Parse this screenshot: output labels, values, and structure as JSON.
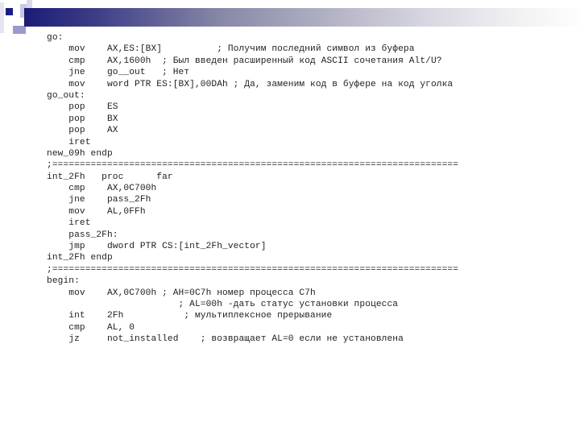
{
  "slide": {
    "code_lines": [
      "go:",
      "    mov    AX,ES:[BX]          ; Получим последний символ из буфера",
      "    cmp    AX,1600h  ; Был введен расширенный код ASCII сочетания Alt/U?",
      "    jne    go__out   ; Нет",
      "    mov    word PTR ES:[BX],00DAh ; Да, заменим код в буфере на код уголка",
      "go_out:",
      "    pop    ES",
      "    pop    BX",
      "    pop    AX",
      "    iret",
      "new_09h endp",
      ";==========================================================================",
      "int_2Fh   proc      far",
      "    cmp    AX,0C700h",
      "    jne    pass_2Fh",
      "    mov    AL,0FFh",
      "    iret",
      "    pass_2Fh:",
      "    jmp    dword PTR CS:[int_2Fh_vector]",
      "int_2Fh endp",
      ";==========================================================================",
      "begin:",
      "    mov    AX,0C700h ; AH=0C7h номер процесса C7h",
      "                        ; AL=00h -дать статус установки процесса",
      "    int    2Fh           ; мультиплексное прерывание",
      "    cmp    AL, 0",
      "    jz     not_installed    ; возвращает AL=0 если не установлена"
    ]
  },
  "colors": {
    "title_bar_start": "#1c1c78",
    "title_bar_end": "#ffffff",
    "text": "#222222"
  }
}
